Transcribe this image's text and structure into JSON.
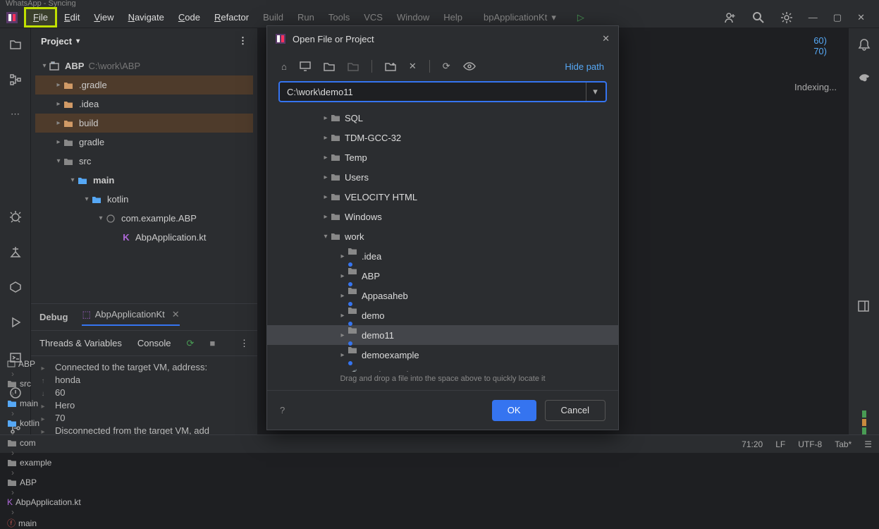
{
  "appTitle": "WhatsApp - Syncing",
  "menu": {
    "file": "File",
    "edit": "Edit",
    "view": "View",
    "navigate": "Navigate",
    "code": "Code",
    "refactor": "Refactor",
    "build": "Build",
    "run": "Run",
    "tools": "Tools",
    "vcs": "VCS",
    "window": "Window",
    "help": "Help"
  },
  "runConfig": "bpApplicationKt",
  "projectPanel": {
    "title": "Project",
    "root": {
      "name": "ABP",
      "path": "C:\\work\\ABP"
    },
    "nodes": [
      {
        "label": ".gradle",
        "depth": 1,
        "arrow": "right",
        "folder": "orange",
        "sel": true
      },
      {
        "label": ".idea",
        "depth": 1,
        "arrow": "right",
        "folder": "orange",
        "sel": false
      },
      {
        "label": "build",
        "depth": 1,
        "arrow": "right",
        "folder": "orange",
        "sel": true
      },
      {
        "label": "gradle",
        "depth": 1,
        "arrow": "right",
        "folder": "gray",
        "sel": false
      },
      {
        "label": "src",
        "depth": 1,
        "arrow": "down",
        "folder": "gray",
        "sel": false
      },
      {
        "label": "main",
        "depth": 2,
        "arrow": "down",
        "folder": "blue",
        "sel": false,
        "bold": true
      },
      {
        "label": "kotlin",
        "depth": 3,
        "arrow": "down",
        "folder": "blue",
        "sel": false
      },
      {
        "label": "com.example.ABP",
        "depth": 4,
        "arrow": "down",
        "folder": "pkg",
        "sel": false
      },
      {
        "label": "AbpApplication.kt",
        "depth": 5,
        "arrow": "",
        "folder": "kt",
        "sel": false
      }
    ]
  },
  "indexing": "Indexing...",
  "codeHints": {
    "l1": "60)",
    "l2": "70)"
  },
  "debug": {
    "tab1": "Debug",
    "tab2": "AbpApplicationKt",
    "threads": "Threads & Variables",
    "console": "Console",
    "lines": [
      "Connected to the target VM, address:",
      "honda",
      "60",
      "Hero",
      "70",
      "Disconnected from the target VM, add"
    ]
  },
  "breadcrumb": [
    "ABP",
    "src",
    "main",
    "kotlin",
    "com",
    "example",
    "ABP",
    "AbpApplication.kt",
    "main"
  ],
  "status": {
    "pos": "71:20",
    "le": "LF",
    "enc": "UTF-8",
    "indent": "Tab*"
  },
  "dialog": {
    "title": "Open File or Project",
    "hidePath": "Hide path",
    "path": "C:\\work\\demo11",
    "items": [
      {
        "label": "SQL",
        "depth": 2,
        "arrow": "right",
        "sel": false,
        "dot": false
      },
      {
        "label": "TDM-GCC-32",
        "depth": 2,
        "arrow": "right",
        "sel": false,
        "dot": false
      },
      {
        "label": "Temp",
        "depth": 2,
        "arrow": "right",
        "sel": false,
        "dot": false
      },
      {
        "label": "Users",
        "depth": 2,
        "arrow": "right",
        "sel": false,
        "dot": false
      },
      {
        "label": "VELOCITY HTML",
        "depth": 2,
        "arrow": "right",
        "sel": false,
        "dot": false
      },
      {
        "label": "Windows",
        "depth": 2,
        "arrow": "right",
        "sel": false,
        "dot": false
      },
      {
        "label": "work",
        "depth": 2,
        "arrow": "down",
        "sel": false,
        "dot": false
      },
      {
        "label": ".idea",
        "depth": 3,
        "arrow": "right",
        "sel": false,
        "dot": true
      },
      {
        "label": "ABP",
        "depth": 3,
        "arrow": "right",
        "sel": false,
        "dot": true
      },
      {
        "label": "Appasaheb",
        "depth": 3,
        "arrow": "right",
        "sel": false,
        "dot": true
      },
      {
        "label": "demo",
        "depth": 3,
        "arrow": "right",
        "sel": false,
        "dot": true
      },
      {
        "label": "demo11",
        "depth": 3,
        "arrow": "right",
        "sel": true,
        "dot": true
      },
      {
        "label": "demoexample",
        "depth": 3,
        "arrow": "right",
        "sel": false,
        "dot": true
      },
      {
        "label": "Mockmate.java",
        "depth": 3,
        "arrow": "",
        "sel": false,
        "dot": false,
        "java": true
      }
    ],
    "dragHint": "Drag and drop a file into the space above to quickly locate it",
    "ok": "OK",
    "cancel": "Cancel"
  }
}
